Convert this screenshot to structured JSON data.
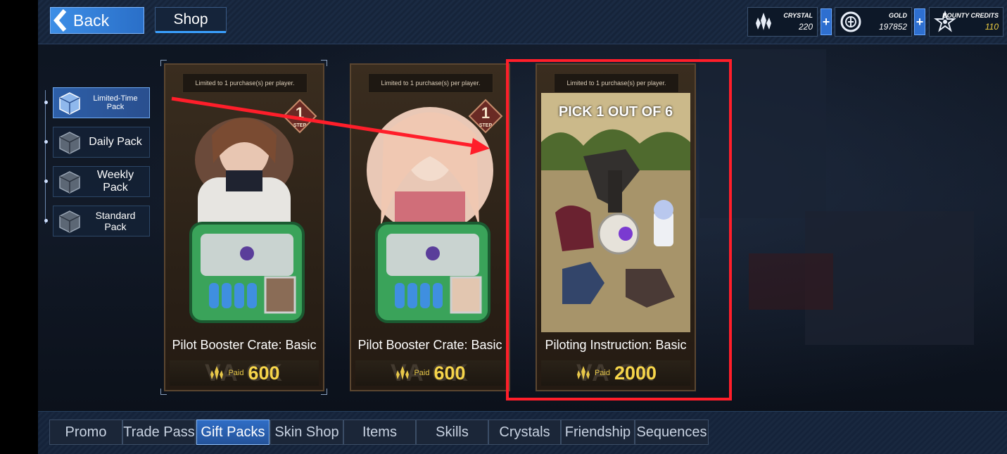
{
  "header": {
    "back_label": "Back",
    "shop_tab": "Shop",
    "currencies": [
      {
        "name": "CRYSTAL",
        "value": "220",
        "icon": "crystal-icon",
        "value_color": "#ffffff"
      },
      {
        "name": "GOLD",
        "value": "197852",
        "icon": "gold-icon",
        "value_color": "#ffffff"
      },
      {
        "name": "BOUNTY CREDITS",
        "value": "110",
        "icon": "bounty-credits-icon",
        "value_color": "#f0d040"
      }
    ],
    "plus_label": "+"
  },
  "side_menu": {
    "items": [
      {
        "label": "Limited-Time Pack",
        "active": true
      },
      {
        "label": "Daily Pack",
        "active": false
      },
      {
        "label": "Weekly Pack",
        "active": false
      },
      {
        "label": "Standard Pack",
        "active": false
      }
    ]
  },
  "products": [
    {
      "limit": "Limited to 1 purchase(s) per player.",
      "step": "1",
      "step_label": "STEP",
      "name": "Pilot Booster Crate: Basic",
      "paid": "Paid",
      "price": "600",
      "watermark": "VA CK"
    },
    {
      "limit": "Limited to 1 purchase(s) per player.",
      "step": "1",
      "step_label": "STEP",
      "name": "Pilot Booster Crate: Basic",
      "paid": "Paid",
      "price": "600",
      "watermark": "VA CK"
    },
    {
      "limit": "Limited to 1 purchase(s) per player.",
      "banner": "PICK 1 OUT OF 6",
      "name": "Piloting Instruction: Basic",
      "paid": "Paid",
      "price": "2000",
      "watermark": "VA CK"
    }
  ],
  "bottom_nav": {
    "tabs": [
      {
        "label": "Promo",
        "active": false
      },
      {
        "label": "Trade Pass",
        "active": false
      },
      {
        "label": "Gift Packs",
        "active": true
      },
      {
        "label": "Skin Shop",
        "active": false
      },
      {
        "label": "Items",
        "active": false
      },
      {
        "label": "Skills",
        "active": false
      },
      {
        "label": "Crystals",
        "active": false
      },
      {
        "label": "Friendship",
        "active": false
      },
      {
        "label": "Sequences",
        "active": false
      }
    ]
  },
  "colors": {
    "accent": "#3aa0ff",
    "highlight": "#ff1e2a",
    "price": "#f6d54a"
  }
}
